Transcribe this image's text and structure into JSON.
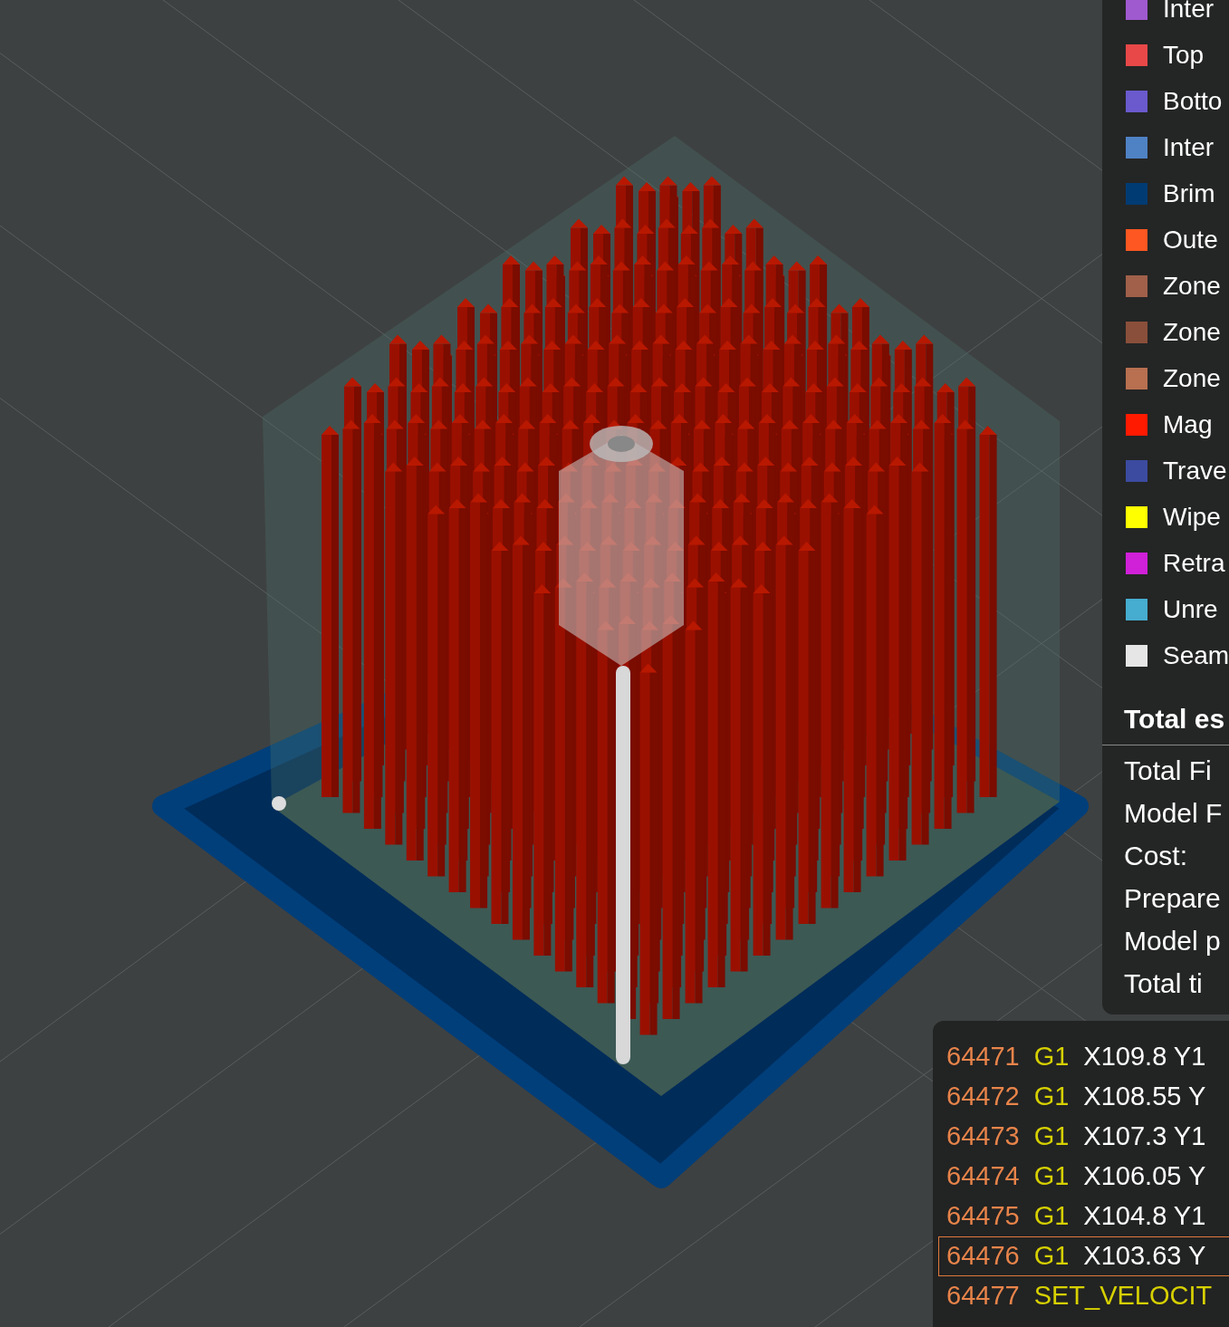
{
  "legend": {
    "items": [
      {
        "label": "Inter",
        "color": "#a05ad0"
      },
      {
        "label": "Top",
        "color": "#e84848"
      },
      {
        "label": "Botto",
        "color": "#6a5acd"
      },
      {
        "label": "Inter",
        "color": "#4f82c4"
      },
      {
        "label": "Brim",
        "color": "#003b73"
      },
      {
        "label": "Oute",
        "color": "#ff5722"
      },
      {
        "label": "Zone",
        "color": "#a0604a"
      },
      {
        "label": "Zone",
        "color": "#8a4f3a"
      },
      {
        "label": "Zone",
        "color": "#b87050"
      },
      {
        "label": "Mag",
        "color": "#ff1a00"
      },
      {
        "label": "Trave",
        "color": "#3c4ba0"
      },
      {
        "label": "Wipe",
        "color": "#ffff00"
      },
      {
        "label": "Retra",
        "color": "#d020d8"
      },
      {
        "label": "Unre",
        "color": "#46acd0"
      },
      {
        "label": "Seam",
        "color": "#e6e6e6"
      }
    ]
  },
  "estimate": {
    "title": "Total es",
    "rows": [
      "Total Fi",
      "Model F",
      "Cost:",
      "Prepare",
      "Model p",
      "Total ti"
    ]
  },
  "gcode": {
    "lines": [
      {
        "number": "64471",
        "command": "G1",
        "args": "X109.8 Y1",
        "selected": false
      },
      {
        "number": "64472",
        "command": "G1",
        "args": "X108.55 Y",
        "selected": false
      },
      {
        "number": "64473",
        "command": "G1",
        "args": "X107.3 Y1",
        "selected": false
      },
      {
        "number": "64474",
        "command": "G1",
        "args": "X106.05 Y",
        "selected": false
      },
      {
        "number": "64475",
        "command": "G1",
        "args": "X104.8 Y1",
        "selected": false
      },
      {
        "number": "64476",
        "command": "G1",
        "args": "X103.63 Y",
        "selected": true
      },
      {
        "number": "64477",
        "command": "SET_VELOCIT",
        "selected": false
      }
    ]
  }
}
